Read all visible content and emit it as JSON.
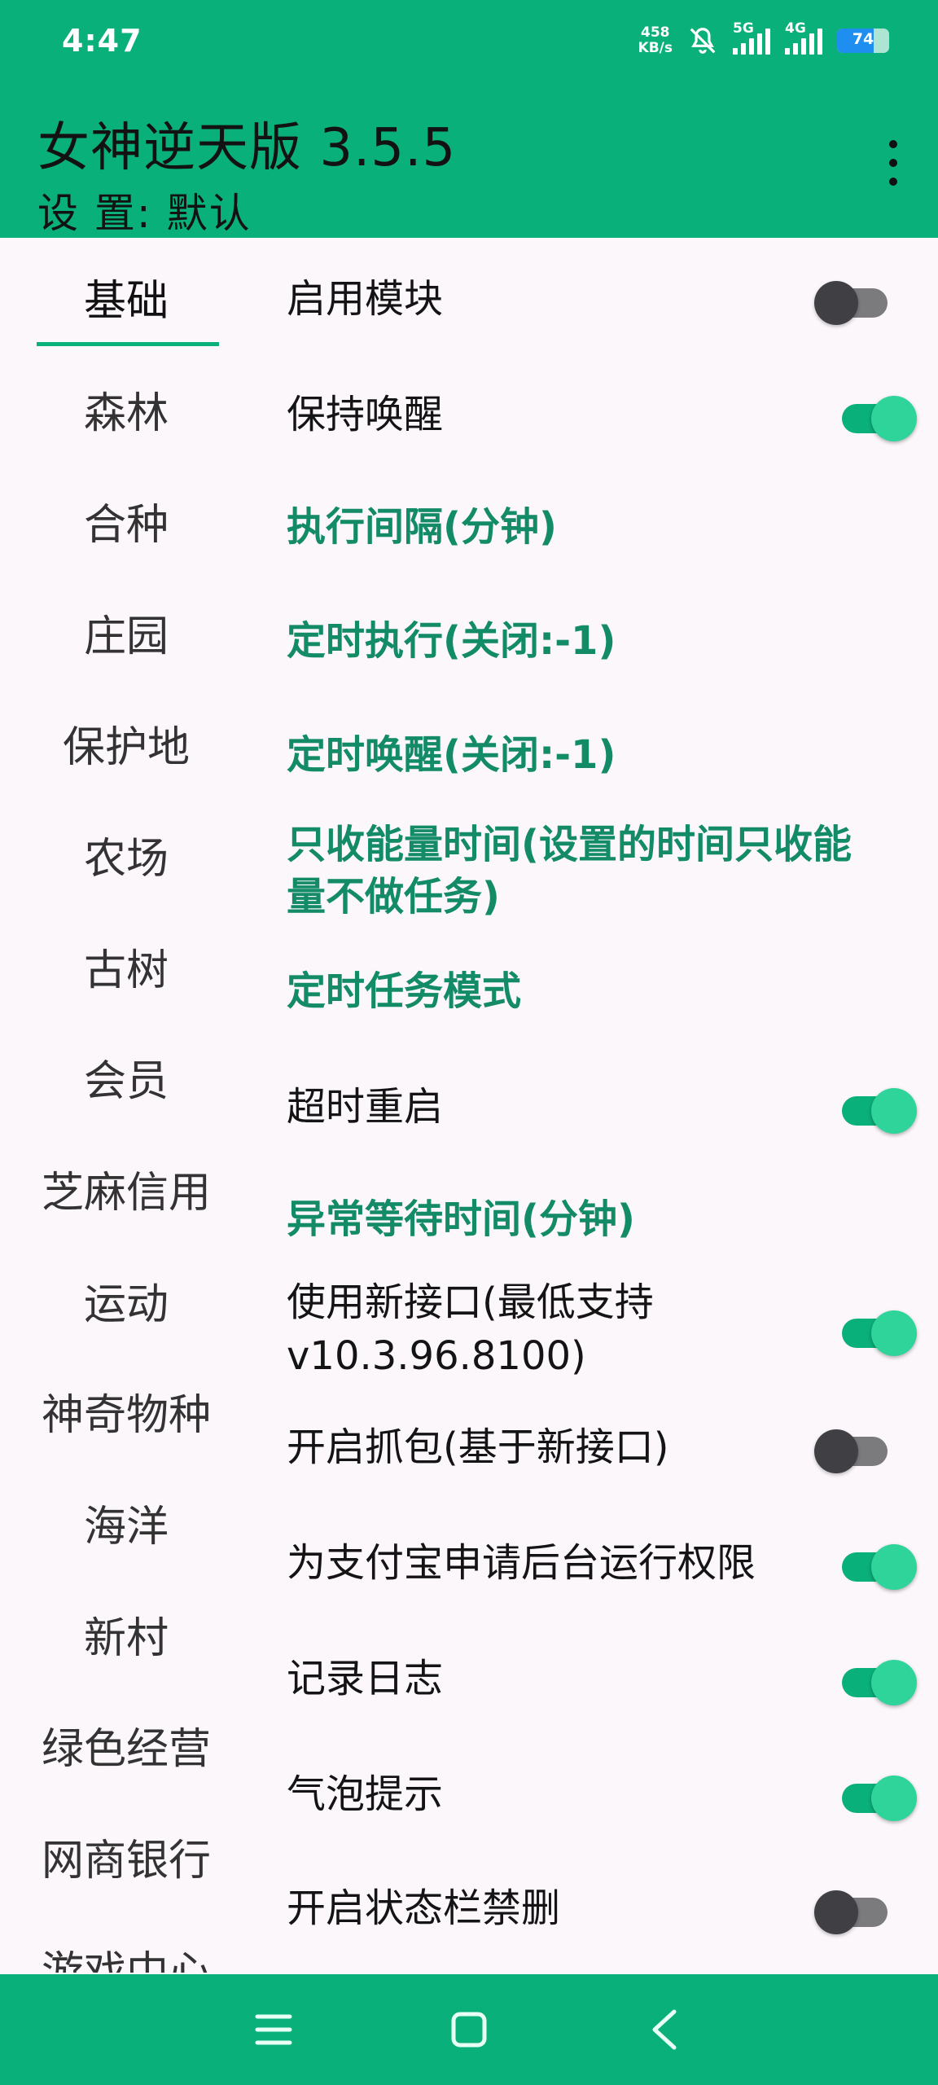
{
  "status_bar": {
    "time": "4:47",
    "speed_value": "458",
    "speed_unit": "KB/s",
    "net1": "5G",
    "net2": "4G",
    "battery": "74"
  },
  "header": {
    "title": "女神逆天版 3.5.5",
    "subtitle": "设 置: 默认"
  },
  "tabs": [
    {
      "label": "基础",
      "active": true
    },
    {
      "label": "森林"
    },
    {
      "label": "合种"
    },
    {
      "label": "庄园"
    },
    {
      "label": "保护地"
    },
    {
      "label": "农场"
    },
    {
      "label": "古树"
    },
    {
      "label": "会员"
    },
    {
      "label": "芝麻信用"
    },
    {
      "label": "运动"
    },
    {
      "label": "神奇物种"
    },
    {
      "label": "海洋"
    },
    {
      "label": "新村"
    },
    {
      "label": "绿色经营"
    },
    {
      "label": "网商银行"
    },
    {
      "label": "游戏中心"
    }
  ],
  "settings": [
    {
      "label": "启用模块",
      "type": "toggle",
      "on": false
    },
    {
      "label": "保持唤醒",
      "type": "toggle",
      "on": true
    },
    {
      "label": "执行间隔(分钟)",
      "type": "link"
    },
    {
      "label": "定时执行(关闭:-1)",
      "type": "link"
    },
    {
      "label": "定时唤醒(关闭:-1)",
      "type": "link"
    },
    {
      "label": "只收能量时间(设置的时间只收能量不做任务)",
      "type": "link"
    },
    {
      "label": "定时任务模式",
      "type": "link"
    },
    {
      "label": "超时重启",
      "type": "toggle",
      "on": true
    },
    {
      "label": "异常等待时间(分钟)",
      "type": "link"
    },
    {
      "label": "使用新接口(最低支持v10.3.96.8100)",
      "type": "toggle",
      "on": true
    },
    {
      "label": "开启抓包(基于新接口)",
      "type": "toggle",
      "on": false
    },
    {
      "label": "为支付宝申请后台运行权限",
      "type": "toggle",
      "on": true
    },
    {
      "label": "记录日志",
      "type": "toggle",
      "on": true
    },
    {
      "label": "气泡提示",
      "type": "toggle",
      "on": true
    },
    {
      "label": "开启状态栏禁删",
      "type": "toggle",
      "on": false
    }
  ],
  "colors": {
    "primary": "#0ab079",
    "link_text": "#138b67",
    "background": "#fbf7fb"
  }
}
